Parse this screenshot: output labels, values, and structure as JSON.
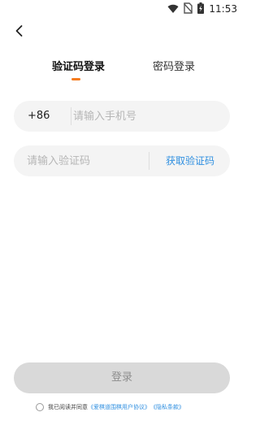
{
  "status_bar": {
    "time": "11:53",
    "icons": [
      "wifi-icon",
      "no-sim-icon",
      "battery-charging-icon"
    ]
  },
  "nav": {
    "back_icon": "chevron-left-icon"
  },
  "tabs": [
    {
      "label": "验证码登录",
      "active": true
    },
    {
      "label": "密码登录",
      "active": false
    }
  ],
  "phone": {
    "country_code": "+86",
    "placeholder": "请输入手机号",
    "value": ""
  },
  "code": {
    "placeholder": "请输入验证码",
    "value": "",
    "get_code_label": "获取验证码"
  },
  "login": {
    "label": "登录",
    "enabled": false
  },
  "agreement": {
    "checked": false,
    "text": "我已阅读并同意",
    "user_agreement": "《爱棋道围棋用户协议》",
    "privacy": "《隐私条款》"
  },
  "colors": {
    "accent": "#f57c1f",
    "link": "#2f8fe0",
    "field_bg": "#f4f4f4",
    "button_disabled_bg": "#d9d9d9"
  }
}
